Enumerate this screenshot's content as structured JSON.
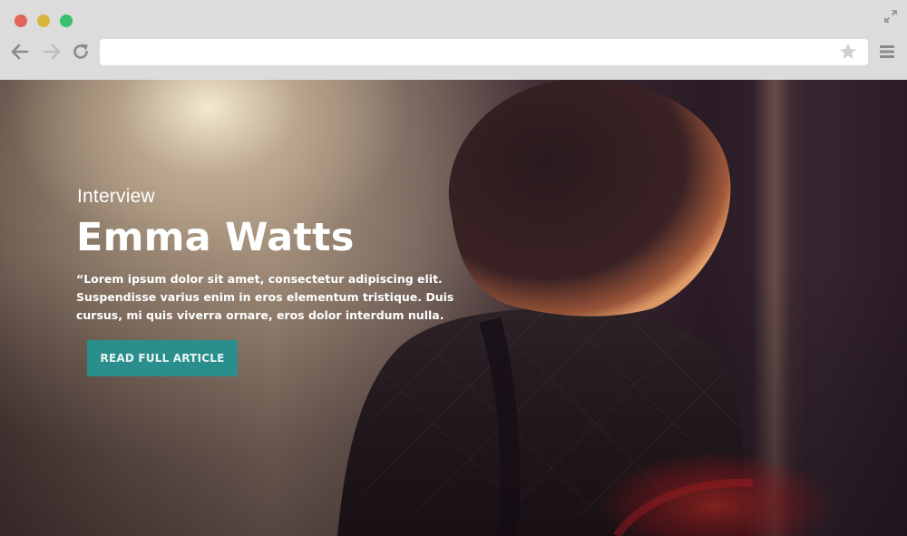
{
  "browser": {
    "address_value": "",
    "icons": {
      "close": "red-dot-icon",
      "minimize": "yellow-dot-icon",
      "maximize": "green-dot-icon",
      "fullscreen": "expand-icon",
      "back": "arrow-left-icon",
      "forward": "arrow-right-icon",
      "reload": "reload-icon",
      "bookmark": "star-icon",
      "menu": "hamburger-menu-icon"
    },
    "colors": {
      "chrome_bg": "#dcdcdc",
      "close": "#e0645b",
      "minimize": "#d8b43e",
      "maximize": "#37c26b"
    }
  },
  "hero": {
    "eyebrow": "Interview",
    "title": "Emma Watts",
    "quote": "“Lorem ipsum dolor sit amet, consectetur adipiscing elit. Suspendisse varius enim in eros elementum tristique. Duis cursus, mi quis viverra ornare, eros dolor interdum nulla.",
    "cta_label": "Read Full Article",
    "colors": {
      "cta_bg": "#2a8e8c",
      "text": "#ffffff"
    }
  }
}
